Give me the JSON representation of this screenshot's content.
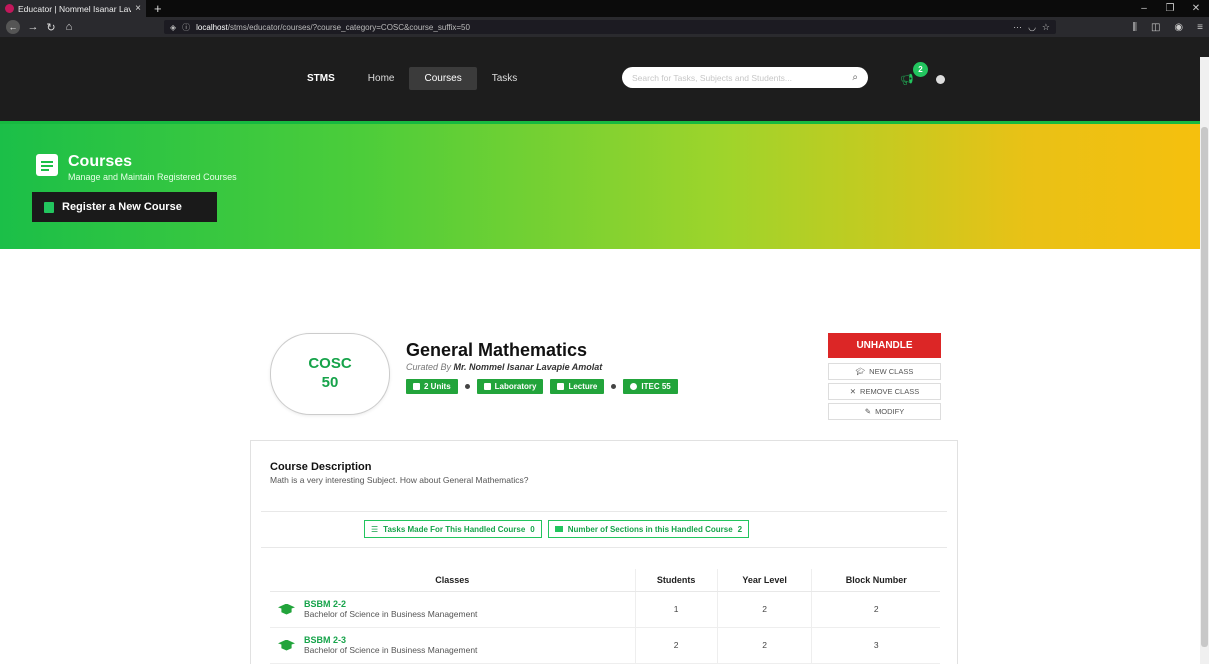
{
  "browser": {
    "tab_title": "Educator | Nommel Isanar Lav...",
    "tab_close": "×",
    "new_tab": "+",
    "url_host": "localhost",
    "url_path": "/stms/educator/courses/?course_category=COSC&course_suffix=50"
  },
  "nav": {
    "brand": "STMS",
    "items": [
      "Home",
      "Courses",
      "Tasks"
    ],
    "search_placeholder": "Search for Tasks, Subjects and Students...",
    "notification_count": "2"
  },
  "hero": {
    "title": "Courses",
    "subtitle": "Manage and Maintain Registered Courses",
    "register_label": "Register a New Course"
  },
  "course": {
    "category": "COSC",
    "suffix": "50",
    "title": "General Mathematics",
    "curated_prefix": "Curated By",
    "curator": "Mr. Nommel Isanar Lavapie Amolat",
    "tags": [
      "2 Units",
      "Laboratory",
      "Lecture",
      "ITEC 55"
    ]
  },
  "actions": {
    "unhandle": "UNHANDLE",
    "new_class": "NEW CLASS",
    "remove_class": "REMOVE CLASS",
    "modify": "MODIFY"
  },
  "description": {
    "heading": "Course Description",
    "text": "Math is a very interesting Subject. How about General Mathematics?"
  },
  "stats": {
    "tasks_label": "Tasks Made For This Handled Course",
    "tasks_count": "0",
    "sections_label": "Number of Sections in this Handled Course",
    "sections_count": "2"
  },
  "table": {
    "headers": [
      "Classes",
      "Students",
      "Year Level",
      "Block Number"
    ],
    "rows": [
      {
        "code": "BSBM 2-2",
        "name": "Bachelor of Science in Business Management",
        "students": "1",
        "year": "2",
        "block": "2"
      },
      {
        "code": "BSBM 2-3",
        "name": "Bachelor of Science in Business Management",
        "students": "2",
        "year": "2",
        "block": "3"
      }
    ]
  },
  "colors": {
    "accent": "#22c55e",
    "danger": "#dc2626",
    "header_bg": "#1d1d1d"
  }
}
